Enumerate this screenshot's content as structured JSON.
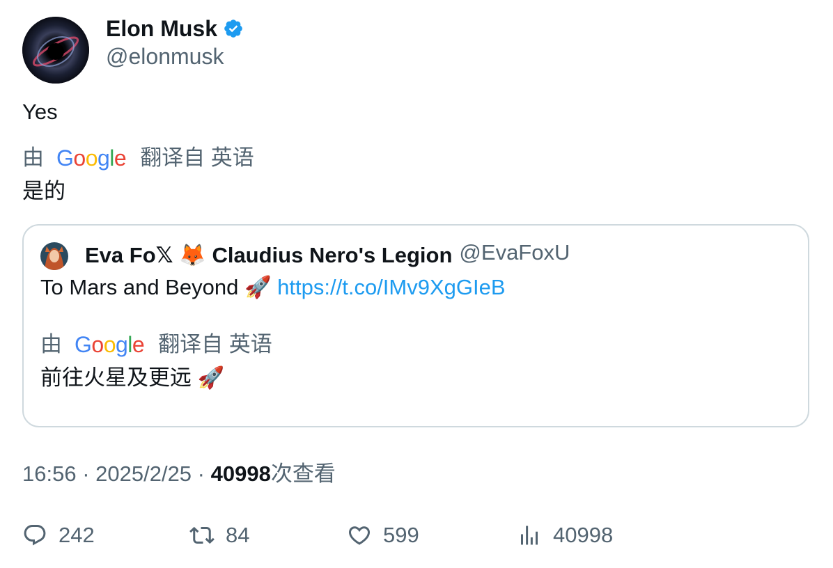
{
  "author": {
    "name": "Elon Musk",
    "handle": "@elonmusk",
    "verified": true,
    "avatar_icon": "black-hole-avatar"
  },
  "tweet": {
    "text": "Yes",
    "translation": {
      "prefix": "由",
      "provider": "Google",
      "suffix": "翻译自 英语",
      "text": "是的"
    }
  },
  "quoted_tweet": {
    "name": "Eva Fo𝕏 🦊 Claudius Nero's Legion",
    "handle": "@EvaFoxU",
    "avatar_icon": "fox-girl-avatar",
    "text": "To Mars and Beyond 🚀",
    "link": "https://t.co/IMv9XgGIeB",
    "translation": {
      "prefix": "由",
      "provider": "Google",
      "suffix": "翻译自 英语",
      "text": "前往火星及更远 🚀"
    }
  },
  "meta": {
    "time": "16:56",
    "separator": " · ",
    "date": "2025/2/25",
    "views": "40998",
    "views_label": "次查看"
  },
  "actions": {
    "replies": "242",
    "retweets": "84",
    "likes": "599",
    "views": "40998"
  },
  "colors": {
    "secondary_text": "#536471",
    "link": "#1d9bf0",
    "verified": "#1d9bf0",
    "border": "#cfd9de"
  }
}
